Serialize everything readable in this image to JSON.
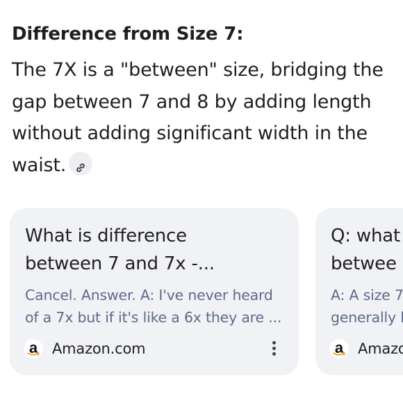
{
  "section": {
    "heading": "Difference from Size 7:",
    "body": "The 7X is a \"between\" size, bridging the gap between 7 and 8 by adding length without adding significant width in the waist.",
    "link_icon": "link-icon"
  },
  "cards": [
    {
      "title": "What is difference\nbetween 7 and 7x -...",
      "snippet": "Cancel. Answer. A: I've never heard\nof a 7x but if it's like a 6x they are ...",
      "source": "Amazon.com",
      "source_icon": "amazon-logo-icon",
      "menu_icon": "more-vert-icon"
    },
    {
      "title": "Q: what\nbetwee",
      "snippet": "A: A size 7\ngenerally l",
      "source": "Amazo",
      "source_icon": "amazon-logo-icon"
    }
  ]
}
